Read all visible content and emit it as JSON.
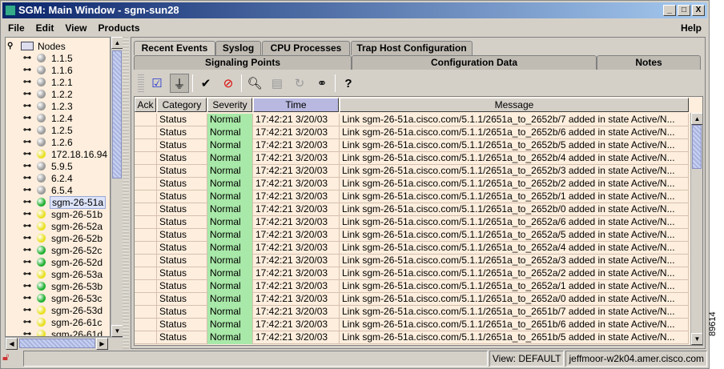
{
  "window": {
    "title": "SGM: Main Window - sgm-sun28",
    "controls": [
      "_",
      "□",
      "X"
    ]
  },
  "menu": {
    "items": [
      "File",
      "Edit",
      "View",
      "Products"
    ],
    "help": "Help"
  },
  "tree": {
    "root": "Nodes",
    "nodes": [
      {
        "label": "1.1.5",
        "status": "gray"
      },
      {
        "label": "1.1.6",
        "status": "gray"
      },
      {
        "label": "1.2.1",
        "status": "gray"
      },
      {
        "label": "1.2.2",
        "status": "gray"
      },
      {
        "label": "1.2.3",
        "status": "gray"
      },
      {
        "label": "1.2.4",
        "status": "gray"
      },
      {
        "label": "1.2.5",
        "status": "gray"
      },
      {
        "label": "1.2.6",
        "status": "gray"
      },
      {
        "label": "172.18.16.94",
        "status": "yellow"
      },
      {
        "label": "5.9.5",
        "status": "gray"
      },
      {
        "label": "6.2.4",
        "status": "gray"
      },
      {
        "label": "6.5.4",
        "status": "gray"
      },
      {
        "label": "sgm-26-51a",
        "status": "green",
        "selected": true
      },
      {
        "label": "sgm-26-51b",
        "status": "yellow"
      },
      {
        "label": "sgm-26-52a",
        "status": "yellow"
      },
      {
        "label": "sgm-26-52b",
        "status": "yellow"
      },
      {
        "label": "sgm-26-52c",
        "status": "green"
      },
      {
        "label": "sgm-26-52d",
        "status": "green"
      },
      {
        "label": "sgm-26-53a",
        "status": "yellow"
      },
      {
        "label": "sgm-26-53b",
        "status": "green"
      },
      {
        "label": "sgm-26-53c",
        "status": "green"
      },
      {
        "label": "sgm-26-53d",
        "status": "yellow"
      },
      {
        "label": "sgm-26-61c",
        "status": "yellow"
      },
      {
        "label": "sgm-26-61d",
        "status": "yellow"
      }
    ]
  },
  "colors": {
    "gray": "#9a9a9a",
    "yellow": "#e8e020",
    "green": "#20b030"
  },
  "tabs": {
    "row1": [
      "Recent Events",
      "Syslog",
      "CPU Processes",
      "Trap Host Configuration"
    ],
    "row2": [
      "Signaling Points",
      "Configuration Data",
      "Notes"
    ]
  },
  "toolbar": [
    "select-all-icon",
    "filter-icon",
    "acknowledge-icon",
    "unacknowledge-icon",
    "search-icon",
    "details-icon",
    "refresh-icon",
    "find-icon",
    "help-icon"
  ],
  "table": {
    "columns": [
      "Ack",
      "Category",
      "Severity",
      "Time",
      "Message"
    ],
    "rows": [
      [
        "",
        "Status",
        "Normal",
        "17:42:21 3/20/03",
        "Link sgm-26-51a.cisco.com/5.1.1/2651a_to_2652b/7 added in state Active/N..."
      ],
      [
        "",
        "Status",
        "Normal",
        "17:42:21 3/20/03",
        "Link sgm-26-51a.cisco.com/5.1.1/2651a_to_2652b/6 added in state Active/N..."
      ],
      [
        "",
        "Status",
        "Normal",
        "17:42:21 3/20/03",
        "Link sgm-26-51a.cisco.com/5.1.1/2651a_to_2652b/5 added in state Active/N..."
      ],
      [
        "",
        "Status",
        "Normal",
        "17:42:21 3/20/03",
        "Link sgm-26-51a.cisco.com/5.1.1/2651a_to_2652b/4 added in state Active/N..."
      ],
      [
        "",
        "Status",
        "Normal",
        "17:42:21 3/20/03",
        "Link sgm-26-51a.cisco.com/5.1.1/2651a_to_2652b/3 added in state Active/N..."
      ],
      [
        "",
        "Status",
        "Normal",
        "17:42:21 3/20/03",
        "Link sgm-26-51a.cisco.com/5.1.1/2651a_to_2652b/2 added in state Active/N..."
      ],
      [
        "",
        "Status",
        "Normal",
        "17:42:21 3/20/03",
        "Link sgm-26-51a.cisco.com/5.1.1/2651a_to_2652b/1 added in state Active/N..."
      ],
      [
        "",
        "Status",
        "Normal",
        "17:42:21 3/20/03",
        "Link sgm-26-51a.cisco.com/5.1.1/2651a_to_2652b/0 added in state Active/N..."
      ],
      [
        "",
        "Status",
        "Normal",
        "17:42:21 3/20/03",
        "Link sgm-26-51a.cisco.com/5.1.1/2651a_to_2652a/6 added in state Active/N..."
      ],
      [
        "",
        "Status",
        "Normal",
        "17:42:21 3/20/03",
        "Link sgm-26-51a.cisco.com/5.1.1/2651a_to_2652a/5 added in state Active/N..."
      ],
      [
        "",
        "Status",
        "Normal",
        "17:42:21 3/20/03",
        "Link sgm-26-51a.cisco.com/5.1.1/2651a_to_2652a/4 added in state Active/N..."
      ],
      [
        "",
        "Status",
        "Normal",
        "17:42:21 3/20/03",
        "Link sgm-26-51a.cisco.com/5.1.1/2651a_to_2652a/3 added in state Active/N..."
      ],
      [
        "",
        "Status",
        "Normal",
        "17:42:21 3/20/03",
        "Link sgm-26-51a.cisco.com/5.1.1/2651a_to_2652a/2 added in state Active/N..."
      ],
      [
        "",
        "Status",
        "Normal",
        "17:42:21 3/20/03",
        "Link sgm-26-51a.cisco.com/5.1.1/2651a_to_2652a/1 added in state Active/N..."
      ],
      [
        "",
        "Status",
        "Normal",
        "17:42:21 3/20/03",
        "Link sgm-26-51a.cisco.com/5.1.1/2651a_to_2652a/0 added in state Active/N..."
      ],
      [
        "",
        "Status",
        "Normal",
        "17:42:21 3/20/03",
        "Link sgm-26-51a.cisco.com/5.1.1/2651a_to_2651b/7 added in state Active/N..."
      ],
      [
        "",
        "Status",
        "Normal",
        "17:42:21 3/20/03",
        "Link sgm-26-51a.cisco.com/5.1.1/2651a_to_2651b/6 added in state Active/N..."
      ],
      [
        "",
        "Status",
        "Normal",
        "17:42:21 3/20/03",
        "Link sgm-26-51a.cisco.com/5.1.1/2651a_to_2651b/5 added in state Active/N..."
      ]
    ]
  },
  "statusbar": {
    "view": "View: DEFAULT",
    "host": "jeffmoor-w2k04.amer.cisco.com"
  },
  "figure_id": "89614"
}
